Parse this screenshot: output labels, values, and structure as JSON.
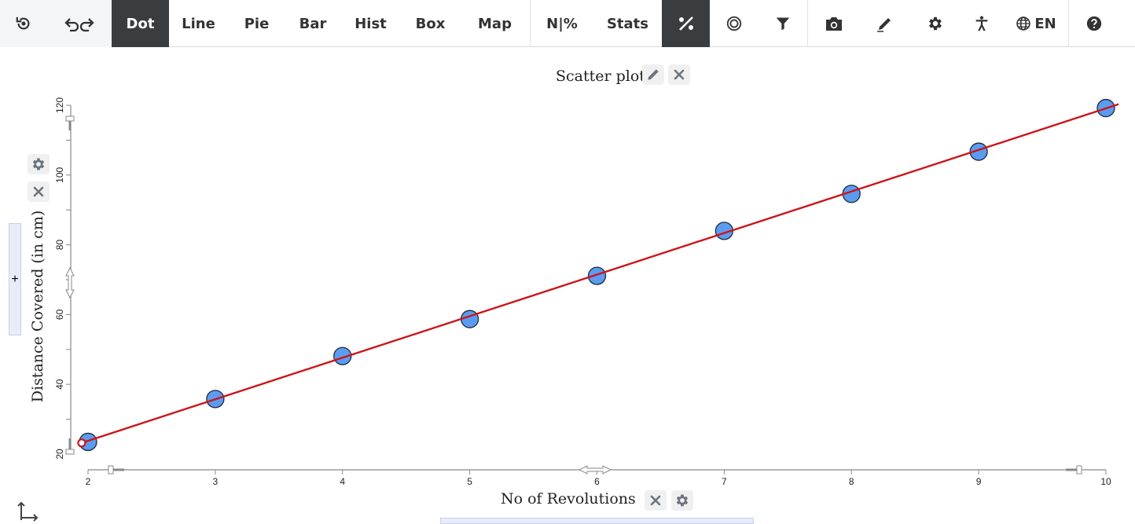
{
  "toolbar": {
    "items": [
      {
        "name": "reset-view-button",
        "icon": "reset-icon",
        "label": "",
        "width": 60,
        "style": "shade"
      },
      {
        "name": "undo-redo-button",
        "icon": "undo-redo-icon",
        "label": "",
        "width": 82,
        "style": "shade"
      },
      {
        "name": "tab-dot",
        "label": "Dot",
        "width": 73,
        "style": "active"
      },
      {
        "name": "tab-line",
        "label": "Line",
        "width": 75
      },
      {
        "name": "tab-pie",
        "label": "Pie",
        "width": 73
      },
      {
        "name": "tab-bar",
        "label": "Bar",
        "width": 70
      },
      {
        "name": "tab-hist",
        "label": "Hist",
        "width": 77
      },
      {
        "name": "tab-box",
        "label": "Box",
        "width": 75
      },
      {
        "name": "tab-map",
        "label": "Map",
        "width": 90,
        "sep": true
      },
      {
        "name": "n-percent-button",
        "label": "N|%",
        "width": 80
      },
      {
        "name": "tab-stats",
        "label": "Stats",
        "width": 87
      },
      {
        "name": "regression-button",
        "icon": "percent-regression-icon",
        "label": "",
        "width": 61,
        "style": "active"
      },
      {
        "name": "target-button",
        "icon": "target-icon",
        "label": "",
        "width": 62
      },
      {
        "name": "filter-button",
        "icon": "filter-icon",
        "label": "",
        "width": 63,
        "sep": true
      },
      {
        "name": "camera-button",
        "icon": "camera-icon",
        "label": "",
        "width": 65
      },
      {
        "name": "pencil-button",
        "icon": "pencil-icon",
        "label": "",
        "width": 66
      },
      {
        "name": "settings-button",
        "icon": "gear-icon",
        "label": "",
        "width": 62
      },
      {
        "name": "accessibility-button",
        "icon": "accessibility-icon",
        "label": "",
        "width": 56
      },
      {
        "name": "language-button",
        "icon": "globe-icon",
        "label": "EN",
        "width": 83,
        "sep": true
      },
      {
        "name": "help-button",
        "icon": "help-icon",
        "label": "",
        "width": 63
      }
    ]
  },
  "colors": {
    "point_fill": "#5b9cf0",
    "point_stroke": "#1e2a3a",
    "trendline": "#cc1518",
    "active_bg": "#3a3d40",
    "icon_grey": "#6c757d"
  },
  "chart_data": {
    "type": "scatter",
    "title": "Scatter plot",
    "xlabel": "No of Revolutions",
    "ylabel": "Distance Covered (in cm)",
    "xlim": [
      2,
      10
    ],
    "ylim": [
      20,
      120
    ],
    "x_ticks": [
      2,
      3,
      4,
      5,
      6,
      7,
      8,
      9,
      10
    ],
    "y_ticks": [
      20,
      40,
      60,
      80,
      100,
      120
    ],
    "series": [
      {
        "x": [
          2,
          3,
          4,
          5,
          6,
          7,
          8,
          9,
          10
        ],
        "y": [
          23.5,
          35.8,
          48.1,
          58.7,
          71.1,
          84,
          94.6,
          106.7,
          119.2
        ]
      }
    ],
    "trendline": {
      "from": [
        1.95,
        23.2
      ],
      "to": [
        10.1,
        120.3
      ]
    },
    "grid": false,
    "legend": "none"
  }
}
